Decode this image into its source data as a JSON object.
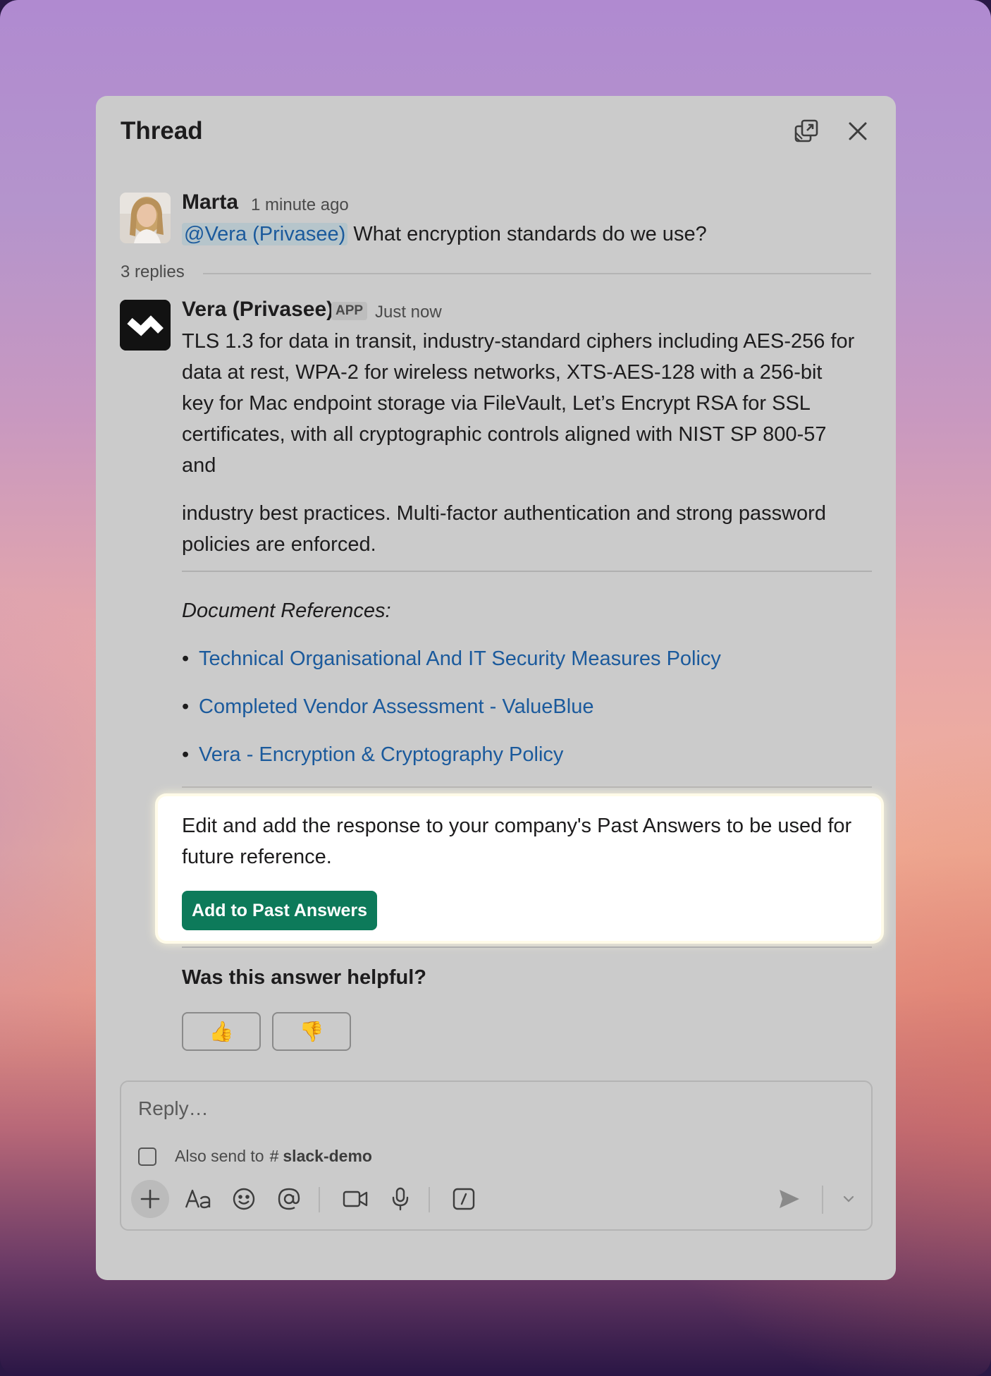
{
  "thread": {
    "title": "Thread",
    "original": {
      "author": "Marta",
      "time": "1 minute ago",
      "mention": "@Vera (Privasee)",
      "text": " What encryption standards do we use?"
    },
    "replies_count": "3 replies",
    "reply": {
      "author": "Vera (Privasee)",
      "badge": "APP",
      "time": "Just now",
      "para1_l1": "TLS 1.3 for data in transit, industry-standard ciphers including AES-256 for",
      "para1_l2": "data at rest, WPA-2 for wireless networks, XTS-AES-128 with a 256-bit",
      "para1_l3": "key for Mac endpoint storage via FileVault, Let’s Encrypt RSA for SSL",
      "para1_l4": "certificates, with all cryptographic controls aligned with NIST SP 800-57",
      "para1_l5": "and",
      "para2_l1": "industry best practices. Multi-factor authentication and strong password",
      "para2_l2": "policies are enforced.",
      "doc_heading": "Document References:",
      "docs": [
        "Technical Organisational And IT Security Measures Policy",
        "Completed Vendor Assessment - ValueBlue",
        "Vera - Encryption & Cryptography Policy"
      ],
      "past_answers_l1": "Edit and add the response to your company's Past Answers to be used for",
      "past_answers_l2": "future reference.",
      "add_button": "Add to Past Answers",
      "helpful_question": "Was this answer helpful?",
      "thumbs_up": "👍",
      "thumbs_down": "👎"
    }
  },
  "composer": {
    "placeholder": "Reply…",
    "also_send": "Also send to",
    "channel": "slack-demo"
  },
  "colors": {
    "panel": "#cbcbcb",
    "link": "#1b5a9c",
    "primary_button": "#0d7a5a"
  }
}
